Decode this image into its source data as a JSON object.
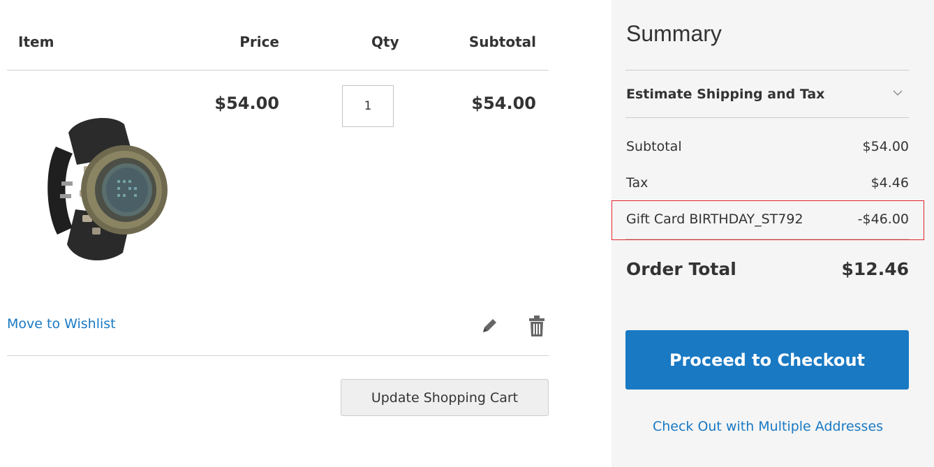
{
  "cart": {
    "headers": {
      "item": "Item",
      "price": "Price",
      "qty": "Qty",
      "subtotal": "Subtotal"
    },
    "product": {
      "image_icon": "wristwatch",
      "price": "$54.00",
      "qty": "1",
      "subtotal": "$54.00"
    },
    "move_to_wishlist": "Move to Wishlist",
    "edit_icon": "pencil-icon",
    "delete_icon": "trash-icon",
    "update_button": "Update Shopping Cart"
  },
  "summary": {
    "title": "Summary",
    "estimate_label": "Estimate Shipping and Tax",
    "subtotal": {
      "label": "Subtotal",
      "value": "$54.00"
    },
    "tax": {
      "label": "Tax",
      "value": "$4.46"
    },
    "gift_card": {
      "label": "Gift Card BIRTHDAY_ST792",
      "value": "-$46.00"
    },
    "order_total": {
      "label": "Order Total",
      "value": "$12.46"
    },
    "checkout_button": "Proceed to Checkout",
    "multi_address_link": "Check Out with Multiple Addresses"
  },
  "colors": {
    "accent": "#1979c3",
    "highlight_border": "#e0242c",
    "summary_bg": "#f5f5f5"
  }
}
